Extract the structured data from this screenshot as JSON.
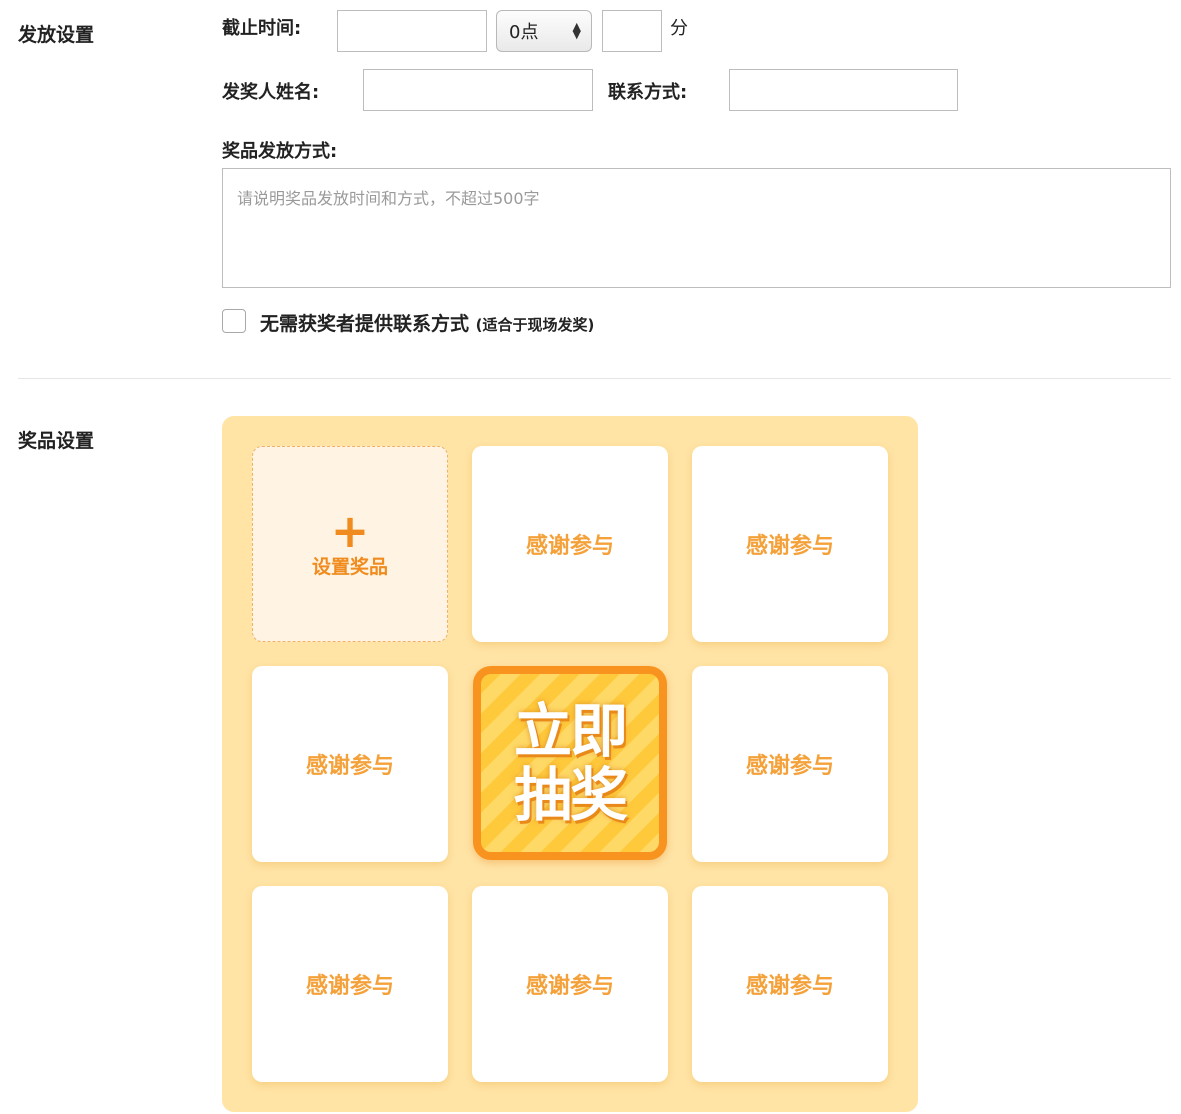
{
  "distribution": {
    "section_label": "发放设置",
    "deadline_label": "截止时间:",
    "deadline_date_value": "",
    "deadline_hour_value": "0点",
    "deadline_minute_value": "",
    "minute_unit": "分",
    "issuer_name_label": "发奖人姓名:",
    "issuer_name_value": "",
    "contact_label": "联系方式:",
    "contact_value": "",
    "method_label": "奖品发放方式:",
    "method_placeholder": "请说明奖品发放时间和方式，不超过500字",
    "no_contact_checkbox_checked": false,
    "no_contact_label": "无需获奖者提供联系方式",
    "no_contact_note": "(适合于现场发奖)"
  },
  "prizes": {
    "section_label": "奖品设置",
    "add_prize_icon": "plus-icon",
    "add_prize_label": "设置奖品",
    "cells": [
      "感谢参与",
      "感谢参与",
      "感谢参与",
      "感谢参与",
      "感谢参与",
      "感谢参与",
      "感谢参与"
    ],
    "draw_button_line1": "立即",
    "draw_button_line2": "抽奖"
  },
  "colors": {
    "grid_background": "#ffe4a6",
    "cell_text": "#f5a13a",
    "add_prize_accent": "#f08c1f",
    "draw_button_border": "#f7931e",
    "draw_button_fill": "#ffc93c"
  }
}
